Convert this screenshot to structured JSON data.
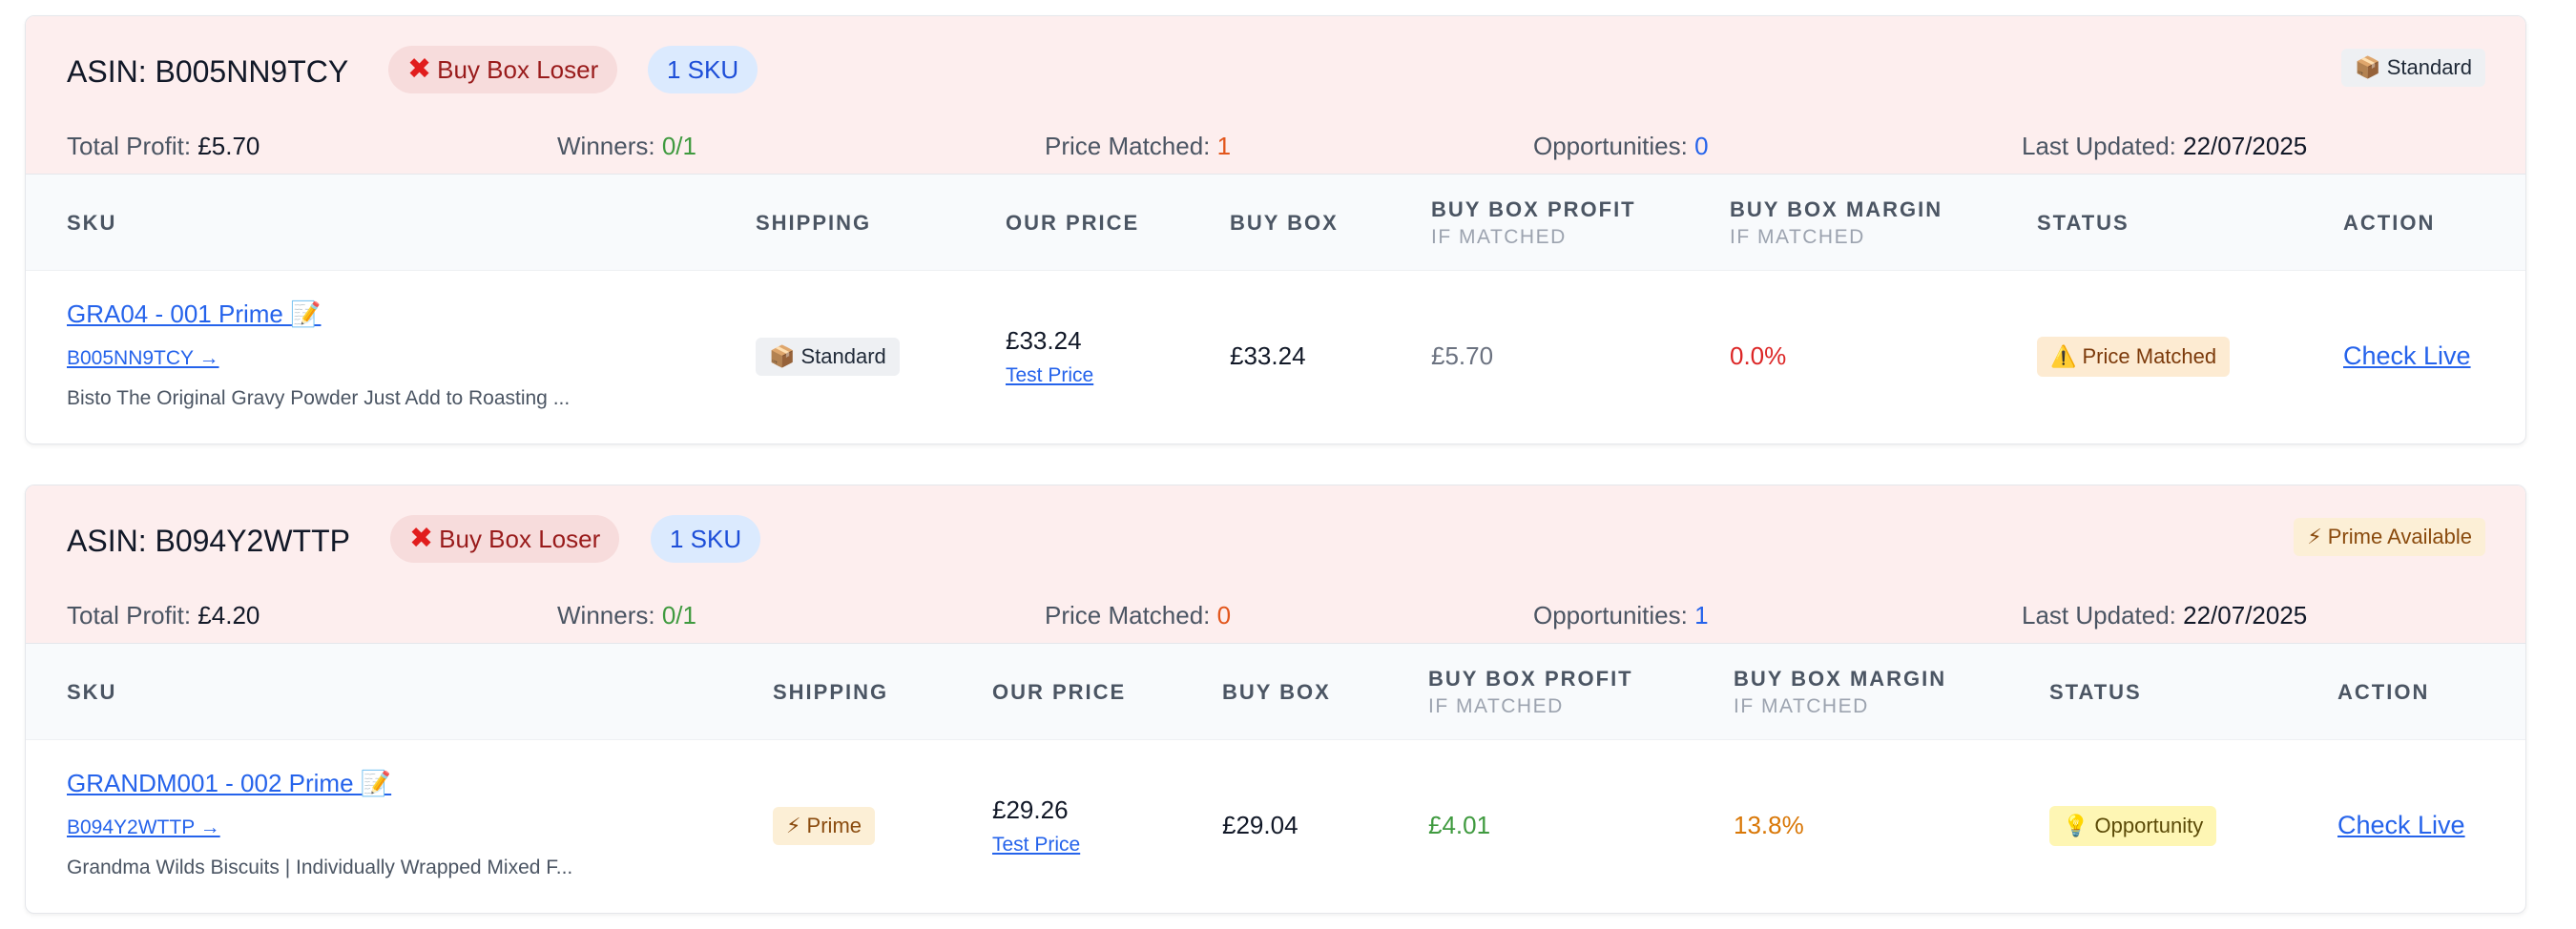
{
  "cards": [
    {
      "asin_label": "ASIN: B005NN9TCY",
      "loser_badge": "Buy Box Loser",
      "loser_icon": "✖",
      "sku_count": "1 SKU",
      "shipping_tag": "📦 Standard",
      "stats": {
        "total_profit_label": "Total Profit:",
        "total_profit": "£5.70",
        "winners_label": "Winners:",
        "winners": "0/1",
        "price_matched_label": "Price Matched:",
        "price_matched": "1",
        "opportunities_label": "Opportunities:",
        "opportunities": "0",
        "last_updated_label": "Last Updated:",
        "last_updated": "22/07/2025"
      },
      "headers": {
        "sku": "SKU",
        "shipping": "SHIPPING",
        "our_price": "OUR PRICE",
        "buy_box": "BUY BOX",
        "bb_profit": "BUY BOX PROFIT",
        "bb_profit_sub": "IF MATCHED",
        "bb_margin": "BUY BOX MARGIN",
        "bb_margin_sub": "IF MATCHED",
        "status": "STATUS",
        "action": "ACTION"
      },
      "row": {
        "sku": "GRA04 - 001 Prime 📝",
        "asin_link": "B005NN9TCY →",
        "description": "Bisto The Original Gravy Powder Just Add to Roasting ...",
        "shipping": "📦 Standard",
        "our_price": "£33.24",
        "test_price": "Test Price",
        "buy_box": "£33.24",
        "bb_profit": "£5.70",
        "bb_margin": "0.0%",
        "status": "⚠️ Price Matched",
        "action": "Check Live"
      },
      "colors": {
        "bb_profit": "#6b7280",
        "bb_margin": "#dc2626"
      }
    },
    {
      "asin_label": "ASIN: B094Y2WTTP",
      "loser_badge": "Buy Box Loser",
      "loser_icon": "✖",
      "sku_count": "1 SKU",
      "shipping_tag": "⚡ Prime Available",
      "stats": {
        "total_profit_label": "Total Profit:",
        "total_profit": "£4.20",
        "winners_label": "Winners:",
        "winners": "0/1",
        "price_matched_label": "Price Matched:",
        "price_matched": "0",
        "opportunities_label": "Opportunities:",
        "opportunities": "1",
        "last_updated_label": "Last Updated:",
        "last_updated": "22/07/2025"
      },
      "headers": {
        "sku": "SKU",
        "shipping": "SHIPPING",
        "our_price": "OUR PRICE",
        "buy_box": "BUY BOX",
        "bb_profit": "BUY BOX PROFIT",
        "bb_profit_sub": "IF MATCHED",
        "bb_margin": "BUY BOX MARGIN",
        "bb_margin_sub": "IF MATCHED",
        "status": "STATUS",
        "action": "ACTION"
      },
      "row": {
        "sku": "GRANDM001 - 002 Prime 📝",
        "asin_link": "B094Y2WTTP →",
        "description": "Grandma Wilds Biscuits | Individually Wrapped Mixed F...",
        "shipping": "⚡ Prime",
        "our_price": "£29.26",
        "test_price": "Test Price",
        "buy_box": "£29.04",
        "bb_profit": "£4.01",
        "bb_margin": "13.8%",
        "status": "💡 Opportunity",
        "action": "Check Live"
      },
      "colors": {
        "bb_profit": "#3f9a3f",
        "bb_margin": "#d97706"
      }
    }
  ]
}
